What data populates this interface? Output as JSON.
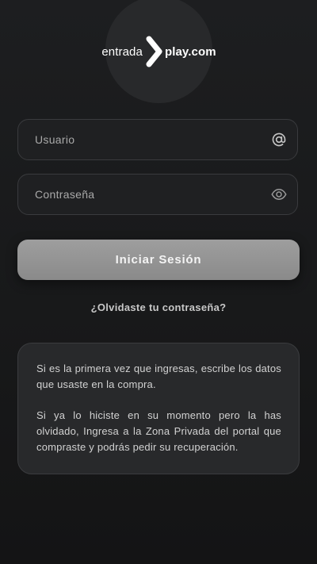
{
  "logo": {
    "text_left": "entrada",
    "text_right": "play.com"
  },
  "form": {
    "user_placeholder": "Usuario",
    "user_icon": "at-icon",
    "password_placeholder": "Contraseña",
    "password_icon": "eye-icon",
    "submit_label": "Iniciar Sesión",
    "forgot_label": "¿Olvidaste tu contraseña?"
  },
  "info": {
    "paragraph_1": "Si es la primera vez que ingresas, escribe los datos que usaste en la compra.",
    "paragraph_2": "Si ya lo hiciste en su momento pero la has olvidado, Ingresa a la Zona Privada del portal que compraste y podrás pedir su recuperación."
  },
  "colors": {
    "background": "#1b1c1e",
    "field_border": "#3a3b3e",
    "button": "#959595",
    "logo_circle": "#28292b"
  }
}
